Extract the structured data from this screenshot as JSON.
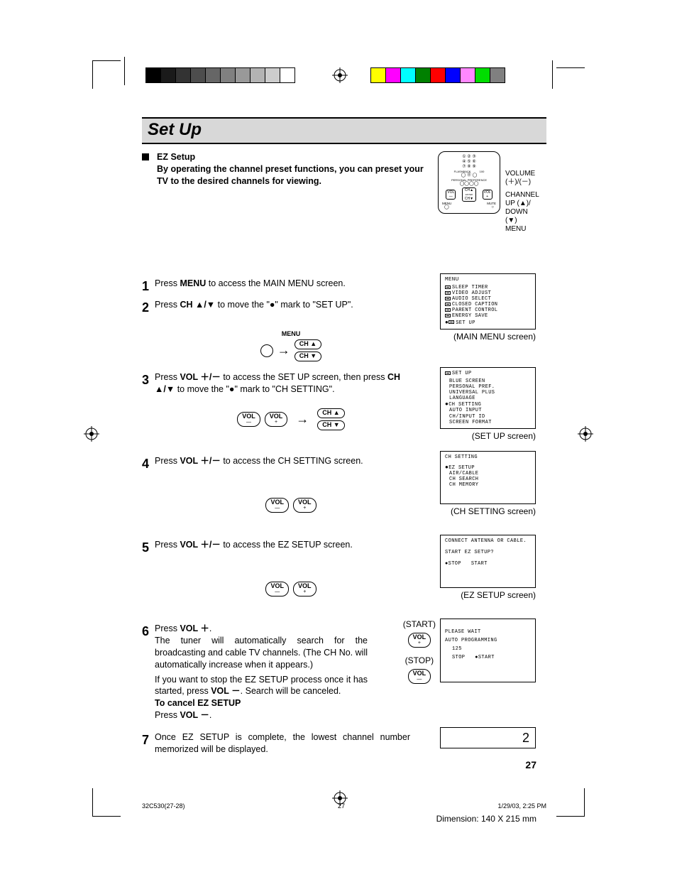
{
  "page_title": "Set Up",
  "section_heading": "EZ Setup",
  "section_intro": "By operating the channel preset functions, you can preset your TV to the desired channels for viewing.",
  "remote_labels": {
    "volume": "VOLUME",
    "volume_signs": "(＋)/(－)",
    "channel": "CHANNEL",
    "up": "UP (▲)/",
    "down": "DOWN (▼)",
    "menu": "MENU"
  },
  "steps": {
    "s1": {
      "num": "1",
      "text_pre": "Press ",
      "bold": "MENU",
      "text_post": " to access the MAIN MENU screen."
    },
    "s2": {
      "num": "2",
      "pre": "Press ",
      "b1": "CH ▲/▼",
      "mid": " to move the \"●\" mark to \"SET UP\"."
    },
    "s3": {
      "num": "3",
      "pre": "Press ",
      "b1": "VOL ＋/－",
      "mid": " to access the SET UP screen, then press ",
      "b2": "CH ▲/▼",
      "post": " to move the \"●\" mark to \"CH SETTING\"."
    },
    "s4": {
      "num": "4",
      "pre": "Press ",
      "b1": "VOL ＋/－",
      "post": " to access the CH SETTING screen."
    },
    "s5": {
      "num": "5",
      "pre": "Press ",
      "b1": "VOL ＋/－",
      "post": " to access the EZ SETUP screen."
    },
    "s6": {
      "num": "6",
      "pre": "Press ",
      "b1": "VOL ＋",
      "post": ".",
      "body": "The tuner will automatically search for the broadcasting and cable TV channels. (The CH No. will automatically increase when it appears.)",
      "body2a": "If you want to stop the EZ SETUP process once it has started, press ",
      "body2b": "VOL －",
      "body2c": ". Search will be canceled.",
      "cancel_head": "To cancel EZ SETUP",
      "cancel_pre": "Press ",
      "cancel_b": "VOL －",
      "cancel_post": "."
    },
    "s7": {
      "num": "7",
      "text": "Once EZ SETUP is complete, the lowest channel number memorized will be displayed."
    }
  },
  "control_labels": {
    "menu": "MENU",
    "ch_up": "CH ▲",
    "ch_down": "CH ▼",
    "vol_minus_lbl": "VOL",
    "vol_minus_sub": "—",
    "vol_plus_lbl": "VOL",
    "vol_plus_sub": "+",
    "start": "(START)",
    "stop": "(STOP)"
  },
  "screens": {
    "main_menu": {
      "header": "MENU",
      "items": [
        "SLEEP TIMER",
        "VIDEO ADJUST",
        "AUDIO SELECT",
        "CLOSED CAPTION",
        "PARENT CONTROL",
        "ENERGY SAVE",
        "SET UP"
      ],
      "label": "(MAIN MENU screen)"
    },
    "setup": {
      "header": "SET UP",
      "items": [
        "BLUE SCREEN",
        "PERSONAL PREF.",
        "UNIVERSAL PLUS",
        "LANGUAGE",
        "CH SETTING",
        "AUTO INPUT",
        "CH/INPUT ID",
        "SCREEN FORMAT"
      ],
      "selected_index": 4,
      "label": "(SET UP screen)"
    },
    "ch_setting": {
      "header": "CH SETTING",
      "items": [
        "EZ SETUP",
        "AIR/CABLE",
        "CH SEARCH",
        "CH MEMORY"
      ],
      "selected_index": 0,
      "label": "(CH SETTING screen)"
    },
    "ez_setup": {
      "line1": "CONNECT ANTENNA OR CABLE.",
      "line2": "START EZ SETUP?",
      "opt_stop": "●STOP",
      "opt_start": "START",
      "label": "(EZ SETUP screen)"
    },
    "progress": {
      "line1": "PLEASE WAIT",
      "line2": "AUTO PROGRAMMING",
      "num": "125",
      "opt_stop": "STOP",
      "opt_start": "●START"
    },
    "final": "2"
  },
  "footer": {
    "file": "32C530(27-28)",
    "page": "27",
    "timestamp": "1/29/03, 2:25 PM",
    "dimension": "Dimension: 140  X 215 mm",
    "page_number": "27"
  }
}
